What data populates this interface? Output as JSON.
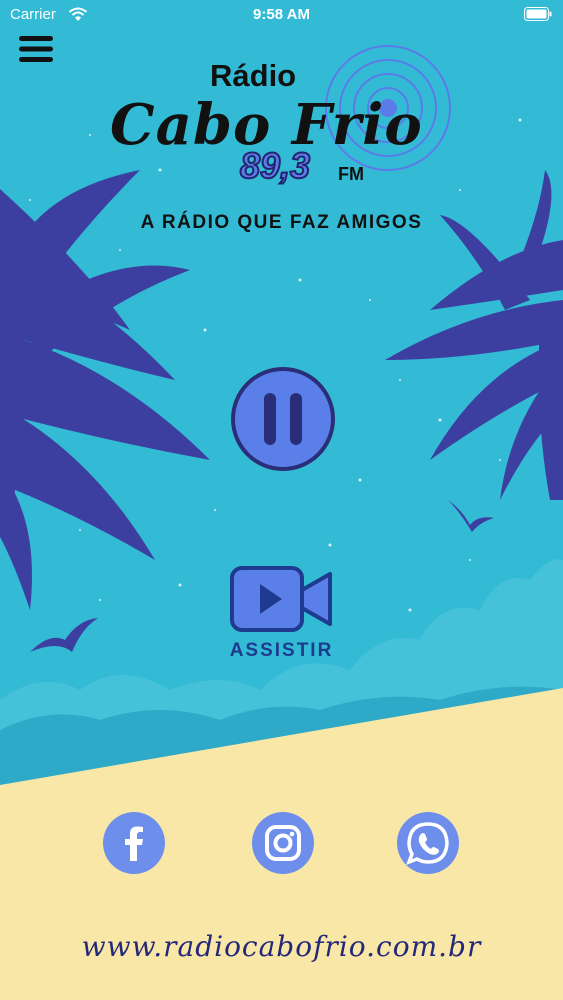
{
  "status_bar": {
    "carrier": "Carrier",
    "time": "9:58 AM",
    "wifi_icon": "wifi-icon",
    "battery_icon": "battery-icon"
  },
  "header": {
    "menu_icon": "hamburger-menu-icon"
  },
  "logo": {
    "line1": "Rádio",
    "line2": "Cabo Frio",
    "frequency": "89,3",
    "band": "FM",
    "signal_icon": "radio-waves-icon"
  },
  "slogan": "A RÁDIO QUE FAZ AMIGOS",
  "player": {
    "state_icon": "pause-icon"
  },
  "video": {
    "icon": "video-camera-icon",
    "label": "ASSISTIR"
  },
  "social": {
    "facebook": "facebook-icon",
    "instagram": "instagram-icon",
    "whatsapp": "whatsapp-icon"
  },
  "footer": {
    "url": "www.radiocabofrio.com.br"
  },
  "colors": {
    "sky": "#33BBD5",
    "palm": "#3D3FA0",
    "sand": "#F8E7A6",
    "button": "#5B7FE8",
    "button_dark": "#2A2E78"
  }
}
